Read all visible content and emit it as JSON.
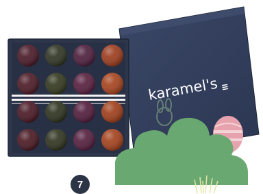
{
  "brand": {
    "logo_text": "karamel's"
  },
  "box": {
    "grid_rows": 4,
    "grid_cols": 4,
    "colors": {
      "tray": "#2d364b",
      "lid": "#33405c",
      "ribbon": "#ffffff",
      "bush": "#6aa872"
    }
  },
  "chocolates": [
    [
      "#4a1b28",
      "#2f3524",
      "#4d1f3d",
      "#9b3d1e"
    ],
    [
      "#4c1c26",
      "#33381f",
      "#58203f",
      "#a5441f"
    ],
    [
      "#4a1a25",
      "#2e331f",
      "#521d3c",
      "#9f3f1c"
    ],
    [
      "#4b1a24",
      "#30341f",
      "#541f3e",
      "#a3421e"
    ]
  ],
  "badge": {
    "number": "7"
  }
}
